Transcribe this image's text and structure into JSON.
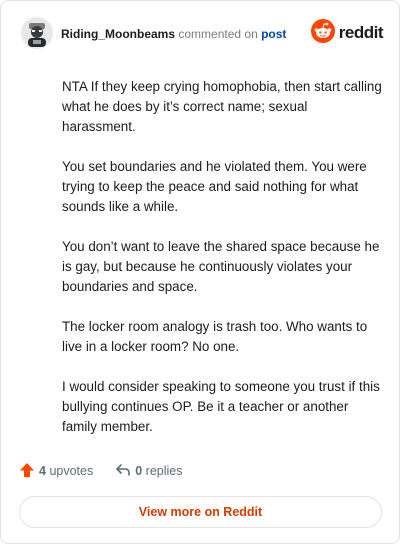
{
  "header": {
    "username": "Riding_Moonbeams",
    "commented_text": "commented on",
    "post_link": "post",
    "brand": "reddit"
  },
  "comment": {
    "paragraphs": [
      "NTA If they keep crying homophobia, then start calling what he does by it’s correct name; sexual harassment.",
      "You set boundaries and he violated them. You were trying to keep the peace and said nothing for what sounds like a while.",
      "You don’t want to leave the shared space because he is gay, but because he continuously violates your boundaries and space.",
      "The locker room analogy is trash too. Who wants to live in a locker room? No one.",
      "I would consider speaking to someone you trust if this bullying continues OP. Be it a teacher or another family member."
    ]
  },
  "footer": {
    "upvotes_count": "4",
    "upvotes_label": "upvotes",
    "replies_count": "0",
    "replies_label": "replies"
  },
  "cta": {
    "label": "View more on Reddit"
  },
  "colors": {
    "accent": "#d93a00",
    "reddit_orange": "#ff4500",
    "link": "#0045ac",
    "muted": "#576f76"
  },
  "icons": {
    "upvote": "upvote-arrow-icon",
    "reply": "reply-arrow-icon",
    "brand": "reddit-snoo-icon",
    "avatar": "user-avatar"
  }
}
